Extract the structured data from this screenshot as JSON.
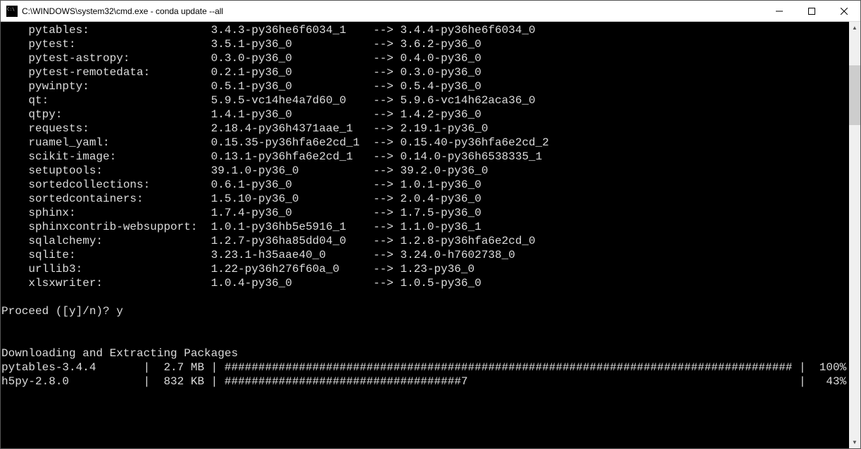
{
  "titlebar": {
    "title": "C:\\WINDOWS\\system32\\cmd.exe - conda  update --all"
  },
  "packages": [
    {
      "name": "pytables:",
      "old": "3.4.3-py36he6f6034_1",
      "new": "3.4.4-py36he6f6034_0"
    },
    {
      "name": "pytest:",
      "old": "3.5.1-py36_0",
      "new": "3.6.2-py36_0"
    },
    {
      "name": "pytest-astropy:",
      "old": "0.3.0-py36_0",
      "new": "0.4.0-py36_0"
    },
    {
      "name": "pytest-remotedata:",
      "old": "0.2.1-py36_0",
      "new": "0.3.0-py36_0"
    },
    {
      "name": "pywinpty:",
      "old": "0.5.1-py36_0",
      "new": "0.5.4-py36_0"
    },
    {
      "name": "qt:",
      "old": "5.9.5-vc14he4a7d60_0",
      "new": "5.9.6-vc14h62aca36_0"
    },
    {
      "name": "qtpy:",
      "old": "1.4.1-py36_0",
      "new": "1.4.2-py36_0"
    },
    {
      "name": "requests:",
      "old": "2.18.4-py36h4371aae_1",
      "new": "2.19.1-py36_0"
    },
    {
      "name": "ruamel_yaml:",
      "old": "0.15.35-py36hfa6e2cd_1",
      "new": "0.15.40-py36hfa6e2cd_2"
    },
    {
      "name": "scikit-image:",
      "old": "0.13.1-py36hfa6e2cd_1",
      "new": "0.14.0-py36h6538335_1"
    },
    {
      "name": "setuptools:",
      "old": "39.1.0-py36_0",
      "new": "39.2.0-py36_0"
    },
    {
      "name": "sortedcollections:",
      "old": "0.6.1-py36_0",
      "new": "1.0.1-py36_0"
    },
    {
      "name": "sortedcontainers:",
      "old": "1.5.10-py36_0",
      "new": "2.0.4-py36_0"
    },
    {
      "name": "sphinx:",
      "old": "1.7.4-py36_0",
      "new": "1.7.5-py36_0"
    },
    {
      "name": "sphinxcontrib-websupport:",
      "old": "1.0.1-py36hb5e5916_1",
      "new": "1.1.0-py36_1"
    },
    {
      "name": "sqlalchemy:",
      "old": "1.2.7-py36ha85dd04_0",
      "new": "1.2.8-py36hfa6e2cd_0"
    },
    {
      "name": "sqlite:",
      "old": "3.23.1-h35aae40_0",
      "new": "3.24.0-h7602738_0"
    },
    {
      "name": "urllib3:",
      "old": "1.22-py36h276f60a_0",
      "new": "1.23-py36_0"
    },
    {
      "name": "xlsxwriter:",
      "old": "1.0.4-py36_0",
      "new": "1.0.5-py36_0"
    }
  ],
  "arrow": "-->",
  "proceed": {
    "prompt": "Proceed ([y]/n)? ",
    "answer": "y"
  },
  "downloading_header": "Downloading and Extracting Packages",
  "downloads": [
    {
      "name": "pytables-3.4.4",
      "size": "2.7 MB",
      "bar": "####################################################################################",
      "pct": "100%"
    },
    {
      "name": "h5py-2.8.0",
      "size": "832 KB",
      "bar": "###################################7",
      "pct": "43%"
    }
  ],
  "sep": " | "
}
